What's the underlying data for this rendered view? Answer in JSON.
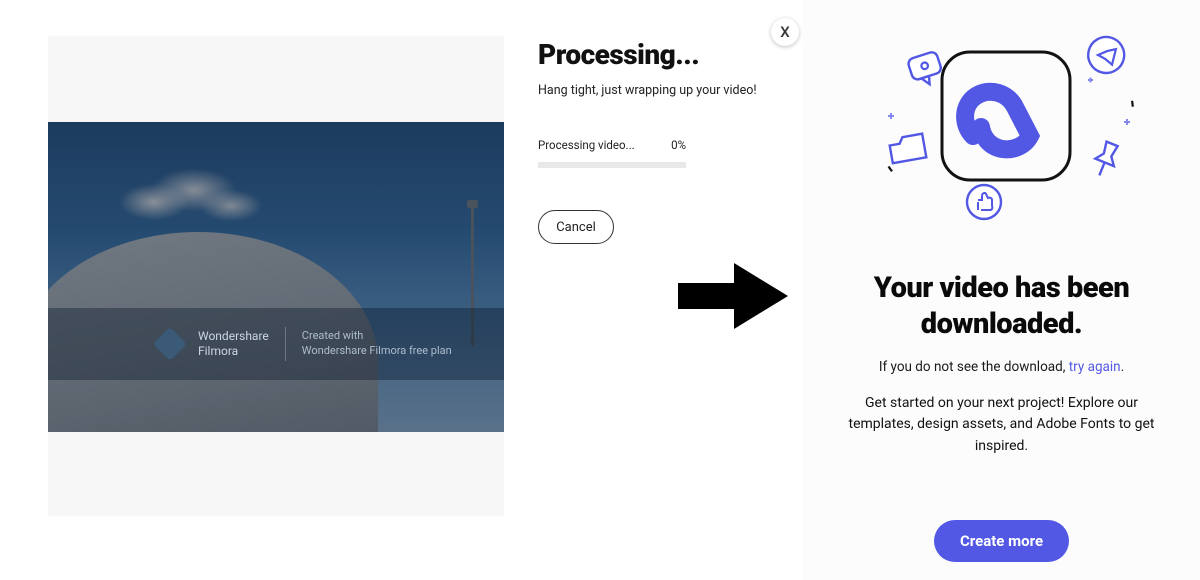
{
  "processing": {
    "title": "Processing...",
    "subtitle": "Hang tight, just wrapping up your video!",
    "status_label": "Processing video...",
    "percent_label": "0%",
    "percent_value": 0,
    "cancel_label": "Cancel"
  },
  "watermark": {
    "brand_line1": "Wondershare",
    "brand_line2": "Filmora",
    "credit_line1": "Created with",
    "credit_line2": "Wondershare Filmora free plan"
  },
  "close_label": "X",
  "downloaded": {
    "title": "Your video has been downloaded.",
    "subtext_prefix": "If you do not see the download, ",
    "try_again_label": "try again",
    "subtext_suffix": ".",
    "body": "Get started on your next project! Explore our templates, design assets, and Adobe Fonts to get inspired.",
    "create_label": "Create more"
  },
  "colors": {
    "accent": "#5258e4",
    "arrow": "#000000"
  }
}
